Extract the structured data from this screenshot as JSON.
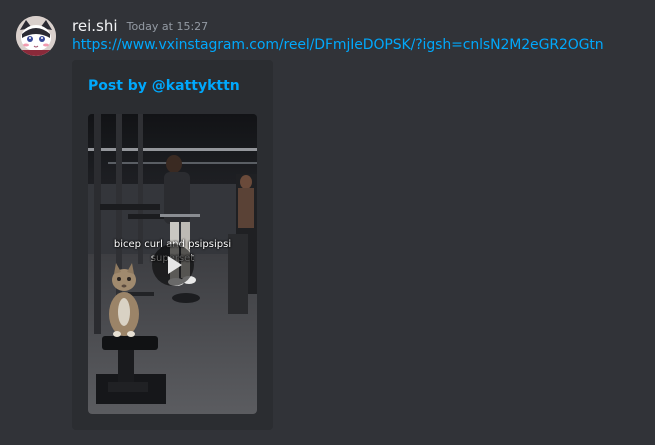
{
  "message": {
    "username": "rei.shi",
    "timestamp": "Today at 15:27",
    "link": "https://www.vxinstagram.com/reel/DFmjIeDOPSK/?igsh=cnlsN2M2eGR2OGtn"
  },
  "embed": {
    "title": "Post by @kattykttn",
    "video": {
      "caption_line1": "bicep curl and psipsipsi",
      "caption_line2": "superset",
      "play_icon": "play-icon"
    }
  },
  "colors": {
    "background": "#313338",
    "embed_background": "#2b2d31",
    "link": "#00a8fc",
    "username": "#f2f3f5",
    "timestamp": "#949ba4"
  }
}
